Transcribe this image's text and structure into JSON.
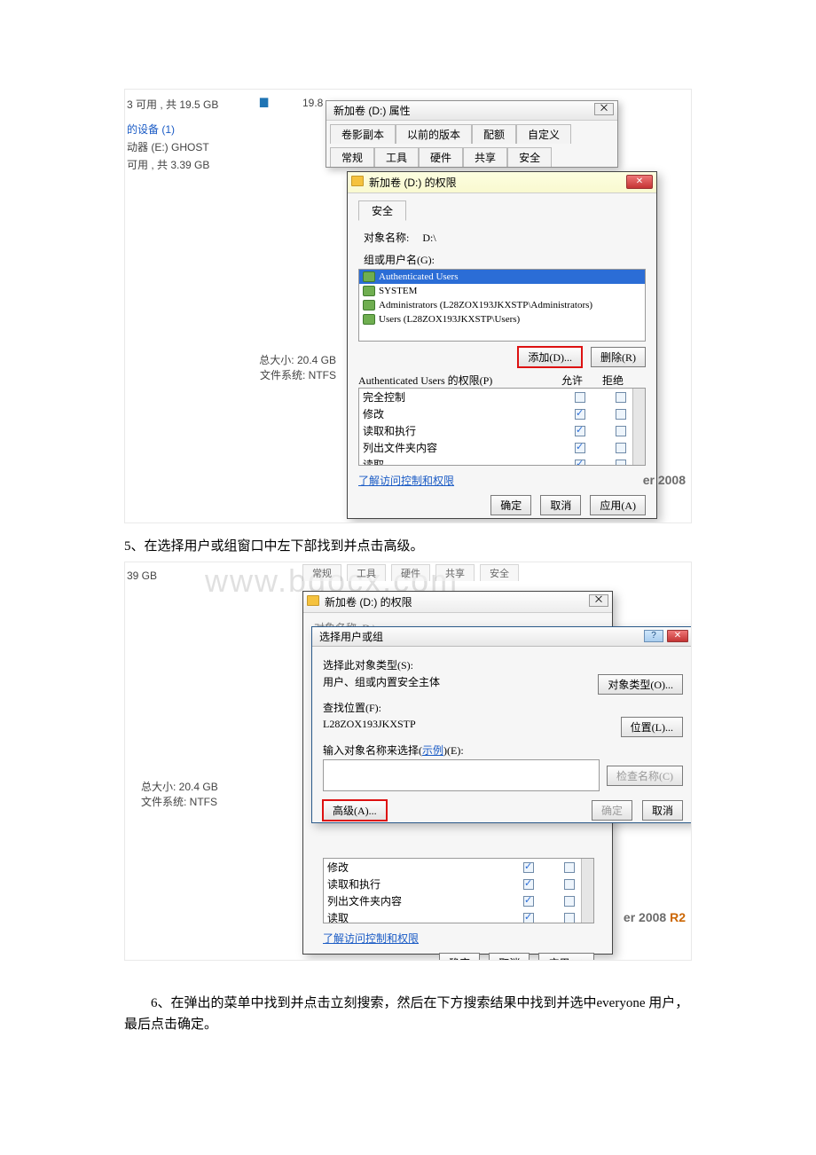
{
  "explorer_bg": {
    "line1": "3 可用 , 共 19.5 GB",
    "ext_num": "19.8",
    "device_header": "的设备 (1)",
    "drive_e": "动器 (E:) GHOST",
    "drive_e_free": "可用 , 共 3.39 GB",
    "total_size": "总大小: 20.4 GB",
    "fs": "文件系统: NTFS"
  },
  "prop_dialog": {
    "title": "新加卷 (D:) 属性",
    "close_glyph": "⨉",
    "tabs_row1": [
      "卷影副本",
      "以前的版本",
      "配额",
      "自定义"
    ],
    "tabs_row2": [
      "常规",
      "工具",
      "硬件",
      "共享",
      "安全"
    ]
  },
  "perm_dialog": {
    "title": "新加卷 (D:) 的权限",
    "close_glyph": "✕",
    "sec_tab": "安全",
    "object_label": "对象名称:",
    "object_value": "D:\\",
    "group_label": "组或用户名(G):",
    "groups": [
      {
        "name": "Authenticated Users",
        "selected": true
      },
      {
        "name": "SYSTEM",
        "selected": false
      },
      {
        "name": "Administrators (L28ZOX193JKXSTP\\Administrators)",
        "selected": false
      },
      {
        "name": "Users (L28ZOX193JKXSTP\\Users)",
        "selected": false
      }
    ],
    "add_btn": "添加(D)...",
    "remove_btn": "删除(R)",
    "perm_for": "Authenticated Users 的权限(P)",
    "col_allow": "允许",
    "col_deny": "拒绝",
    "perms": [
      {
        "label": "完全控制",
        "allow": false,
        "deny": false
      },
      {
        "label": "修改",
        "allow": true,
        "deny": false
      },
      {
        "label": "读取和执行",
        "allow": true,
        "deny": false
      },
      {
        "label": "列出文件夹内容",
        "allow": true,
        "deny": false
      },
      {
        "label": "读取",
        "allow": true,
        "deny": false
      }
    ],
    "learn_link": "了解访问控制和权限",
    "ok": "确定",
    "cancel": "取消",
    "apply": "应用(A)"
  },
  "watermark_rt1": "er 2008",
  "step5": "5、在选择用户或组窗口中左下部找到并点击高级。",
  "shot2": {
    "bg_left": "39 GB",
    "watermark_url": "www.bdocx.com",
    "total_size": "总大小: 20.4 GB",
    "fs": "文件系统: NTFS",
    "tabs_bg": [
      "常规",
      "工具",
      "硬件",
      "共享",
      "安全"
    ]
  },
  "perm_dialog2": {
    "title": "新加卷 (D:) 的权限",
    "close_glyph": "⨉",
    "obj_partial": "对象名称:     D:\\",
    "learn_link": "了解访问控制和权限",
    "ok": "确定",
    "cancel": "取消",
    "apply": "应用(A)",
    "perms": [
      {
        "label": "修改",
        "allow": true,
        "deny": false
      },
      {
        "label": "读取和执行",
        "allow": true,
        "deny": false
      },
      {
        "label": "列出文件夹内容",
        "allow": true,
        "deny": false
      },
      {
        "label": "读取",
        "allow": true,
        "deny": false
      }
    ]
  },
  "select_dialog": {
    "title": "选择用户或组",
    "type_label": "选择此对象类型(S):",
    "type_value": "用户、组或内置安全主体",
    "type_btn": "对象类型(O)...",
    "loc_label": "查找位置(F):",
    "loc_value": "L28ZOX193JKXSTP",
    "loc_btn": "位置(L)...",
    "enter_label_pre": "输入对象名称来选择(",
    "enter_label_link": "示例",
    "enter_label_post": ")(E):",
    "check_btn": "检查名称(C)",
    "adv_btn": "高级(A)...",
    "ok": "确定",
    "cancel": "取消"
  },
  "watermark_rt2_a": "er 2008 ",
  "watermark_rt2_b": "R2",
  "step6": "6、在弹出的菜单中找到并点击立刻搜索，然后在下方搜索结果中找到并选中everyone 用户，最后点击确定。"
}
